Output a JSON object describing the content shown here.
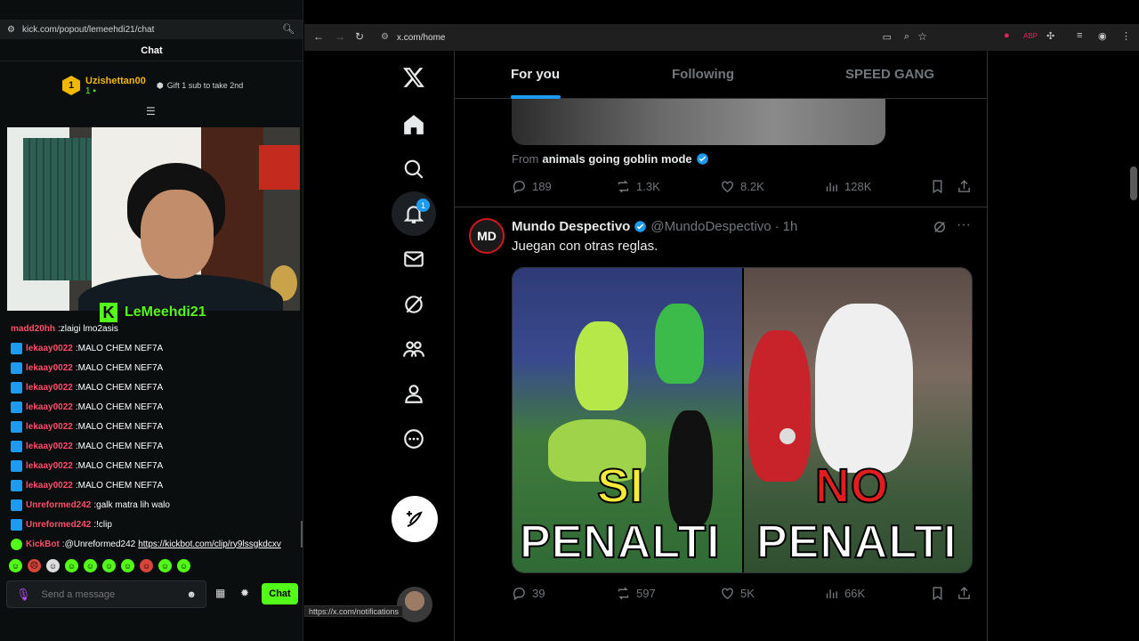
{
  "kick": {
    "url": "kick.com/popout/lemeehdi21/chat",
    "chat_title": "Chat",
    "top_gifter": {
      "rank": "1",
      "name": "Uzishettan00",
      "count": "1",
      "gift_text": "Gift 1 sub to take 2nd"
    },
    "streamer_name": "LeMeehdi21",
    "messages": [
      {
        "user": "madd20hh",
        "text": "zlaigi lmo2asis",
        "color": "#ff4d6a",
        "badge": "none"
      },
      {
        "user": "lekaay0022",
        "text": "MALO CHEM NEF7A",
        "color": "#ff4d6a",
        "badge": "sub"
      },
      {
        "user": "lekaay0022",
        "text": "MALO CHEM NEF7A",
        "color": "#ff4d6a",
        "badge": "sub"
      },
      {
        "user": "lekaay0022",
        "text": "MALO CHEM NEF7A",
        "color": "#ff4d6a",
        "badge": "sub"
      },
      {
        "user": "lekaay0022",
        "text": "MALO CHEM NEF7A",
        "color": "#ff4d6a",
        "badge": "sub"
      },
      {
        "user": "lekaay0022",
        "text": "MALO CHEM NEF7A",
        "color": "#ff4d6a",
        "badge": "sub"
      },
      {
        "user": "lekaay0022",
        "text": "MALO CHEM NEF7A",
        "color": "#ff4d6a",
        "badge": "sub"
      },
      {
        "user": "lekaay0022",
        "text": "MALO CHEM NEF7A",
        "color": "#ff4d6a",
        "badge": "sub"
      },
      {
        "user": "lekaay0022",
        "text": "MALO CHEM NEF7A",
        "color": "#ff4d6a",
        "badge": "sub"
      },
      {
        "user": "Unreformed242",
        "text": "galk matra lih walo",
        "color": "#ff4d6a",
        "badge": "sub"
      },
      {
        "user": "Unreformed242",
        "text": "!clip",
        "color": "#ff4d6a",
        "badge": "sub"
      },
      {
        "user": "KickBot",
        "text": "@Unreformed242",
        "link": "https://kickbot.com/clip/ry9lssgkdcxv",
        "color": "#ff4d6a",
        "badge": "bot"
      }
    ],
    "input_placeholder": "Send a message",
    "send_label": "Chat",
    "accent_color": "#53fc18"
  },
  "browser": {
    "url": "x.com/home",
    "status_link": "https://x.com/notifications"
  },
  "x": {
    "notification_count": "1",
    "tabs": [
      "For you",
      "Following",
      "SPEED GANG"
    ],
    "prev_post": {
      "from_label": "From",
      "from_name": "animals going goblin mode",
      "replies": "189",
      "reposts": "1.3K",
      "likes": "8.2K",
      "views": "128K"
    },
    "post": {
      "avatar_text": "MD",
      "display_name": "Mundo Despectivo",
      "handle": "@MundoDespectivo",
      "dot": "·",
      "time": "1h",
      "text": "Juegan con otras reglas.",
      "media_left_top": "SI",
      "media_left_bottom": "PENALTI",
      "media_right_top": "NO",
      "media_right_bottom": "PENALTI",
      "replies": "39",
      "reposts": "597",
      "likes": "5K",
      "views": "66K"
    },
    "accent_color": "#1d9bf0"
  }
}
